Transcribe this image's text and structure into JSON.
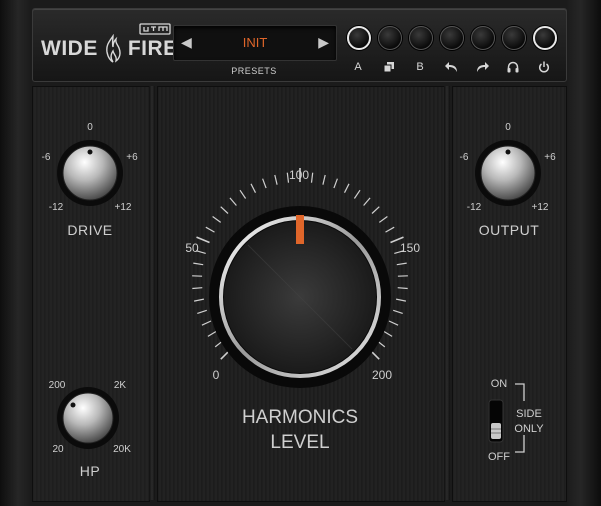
{
  "brand": {
    "word_left": "WIDE",
    "word_right": "FIRE"
  },
  "presets": {
    "current": "INIT",
    "label": "PRESETS",
    "prev": "◀",
    "next": "▶"
  },
  "toolbar": [
    {
      "name": "a",
      "label": "A",
      "lit": true
    },
    {
      "name": "copy",
      "label": "",
      "icon": "copy-icon",
      "lit": false
    },
    {
      "name": "b",
      "label": "B",
      "lit": false
    },
    {
      "name": "undo",
      "label": "",
      "icon": "undo-icon",
      "lit": false
    },
    {
      "name": "redo",
      "label": "",
      "icon": "redo-icon",
      "lit": false
    },
    {
      "name": "monitor",
      "label": "",
      "icon": "headphones-icon",
      "lit": false
    },
    {
      "name": "power",
      "label": "",
      "icon": "power-icon",
      "lit": true
    }
  ],
  "drive": {
    "label": "DRIVE",
    "ticks": {
      "top": "0",
      "left": "-6",
      "right": "+6",
      "bl": "-12",
      "br": "+12"
    }
  },
  "output": {
    "label": "OUTPUT",
    "ticks": {
      "top": "0",
      "left": "-6",
      "right": "+6",
      "bl": "-12",
      "br": "+12"
    }
  },
  "hp": {
    "label": "HP",
    "ticks": {
      "tl": "200",
      "tr": "2K",
      "bl": "20",
      "br": "20K"
    }
  },
  "harmonics": {
    "line1": "HARMONICS",
    "line2": "LEVEL",
    "scale": {
      "s0": "0",
      "s50": "50",
      "s100": "100",
      "s150": "150",
      "s200": "200"
    }
  },
  "side_only": {
    "on": "ON",
    "off": "OFF",
    "line1": "SIDE",
    "line2": "ONLY"
  },
  "colors": {
    "accent": "#e0662a",
    "text": "#cfcfcf"
  }
}
